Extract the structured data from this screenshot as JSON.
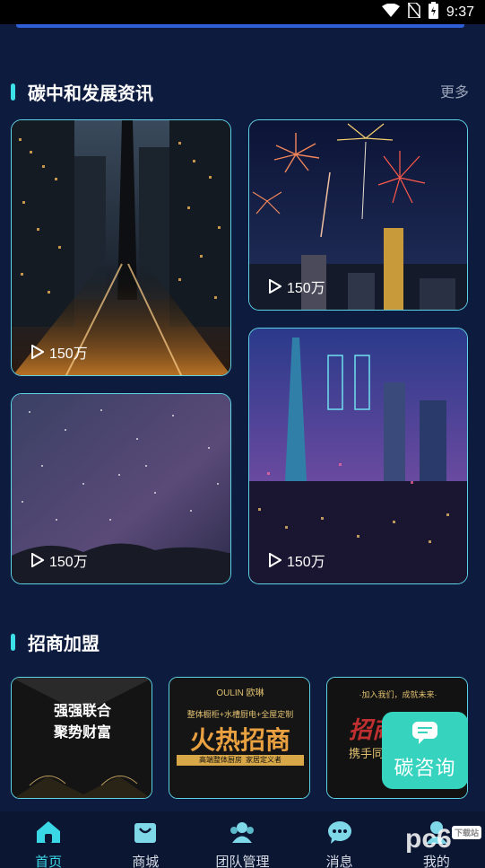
{
  "status_bar": {
    "time": "9:37"
  },
  "news_section": {
    "title": "碳中和发展资讯",
    "more_label": "更多"
  },
  "news_cards": [
    {
      "views": "150万"
    },
    {
      "views": "150万"
    },
    {
      "views": "150万"
    },
    {
      "views": "150万"
    }
  ],
  "biz_section": {
    "title": "招商加盟"
  },
  "biz_cards": [
    {
      "line1": "强强联合",
      "line2": "聚势财富"
    },
    {
      "brand": "OULIN",
      "brand_cn": "欧琳",
      "top_text": "整体橱柜+水槽厨电+全屋定制",
      "headline": "火热招商",
      "sub": "高端整体厨房",
      "tail": "家居定义者"
    },
    {
      "top_text": "·加入我们，成就未来·",
      "headline": "招商",
      "sub": "携手同"
    }
  ],
  "float_button": {
    "label": "碳咨询"
  },
  "tabbar": [
    {
      "label": "首页",
      "active": true
    },
    {
      "label": "商城",
      "active": false
    },
    {
      "label": "团队管理",
      "active": false
    },
    {
      "label": "消息",
      "active": false
    },
    {
      "label": "我的",
      "active": false
    }
  ],
  "watermark": {
    "text": "pc6",
    "sub": "下载站"
  },
  "colors": {
    "accent": "#3ad7e6",
    "background": "#0d1b3e",
    "float_button": "#36d3bf"
  }
}
